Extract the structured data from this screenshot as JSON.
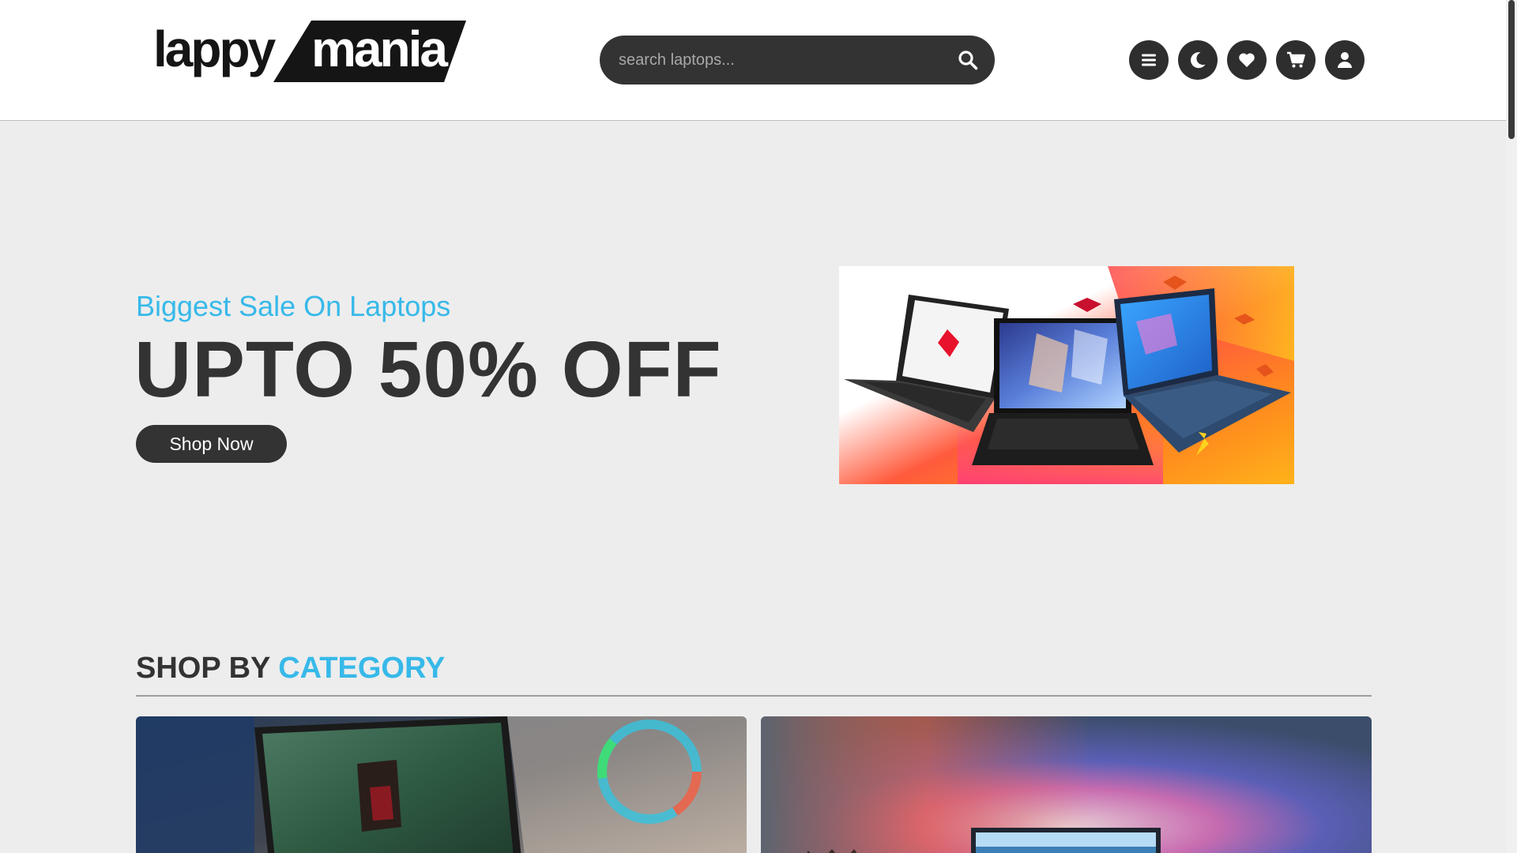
{
  "header": {
    "logo": {
      "part1": "lappy",
      "part2": "mania"
    },
    "search": {
      "placeholder": "search laptops...",
      "value": ""
    },
    "icons": [
      "menu-icon",
      "moon-icon",
      "heart-icon",
      "cart-icon",
      "user-icon"
    ]
  },
  "hero": {
    "subtitle": "Biggest Sale On Laptops",
    "title": "UPTO 50% OFF",
    "button_label": "Shop Now"
  },
  "category": {
    "heading_plain": "SHOP BY",
    "heading_accent": "CATEGORY"
  },
  "colors": {
    "accent": "#37b9e9",
    "dark": "#333333",
    "background": "#ededed",
    "header_bg": "#ffffff"
  }
}
